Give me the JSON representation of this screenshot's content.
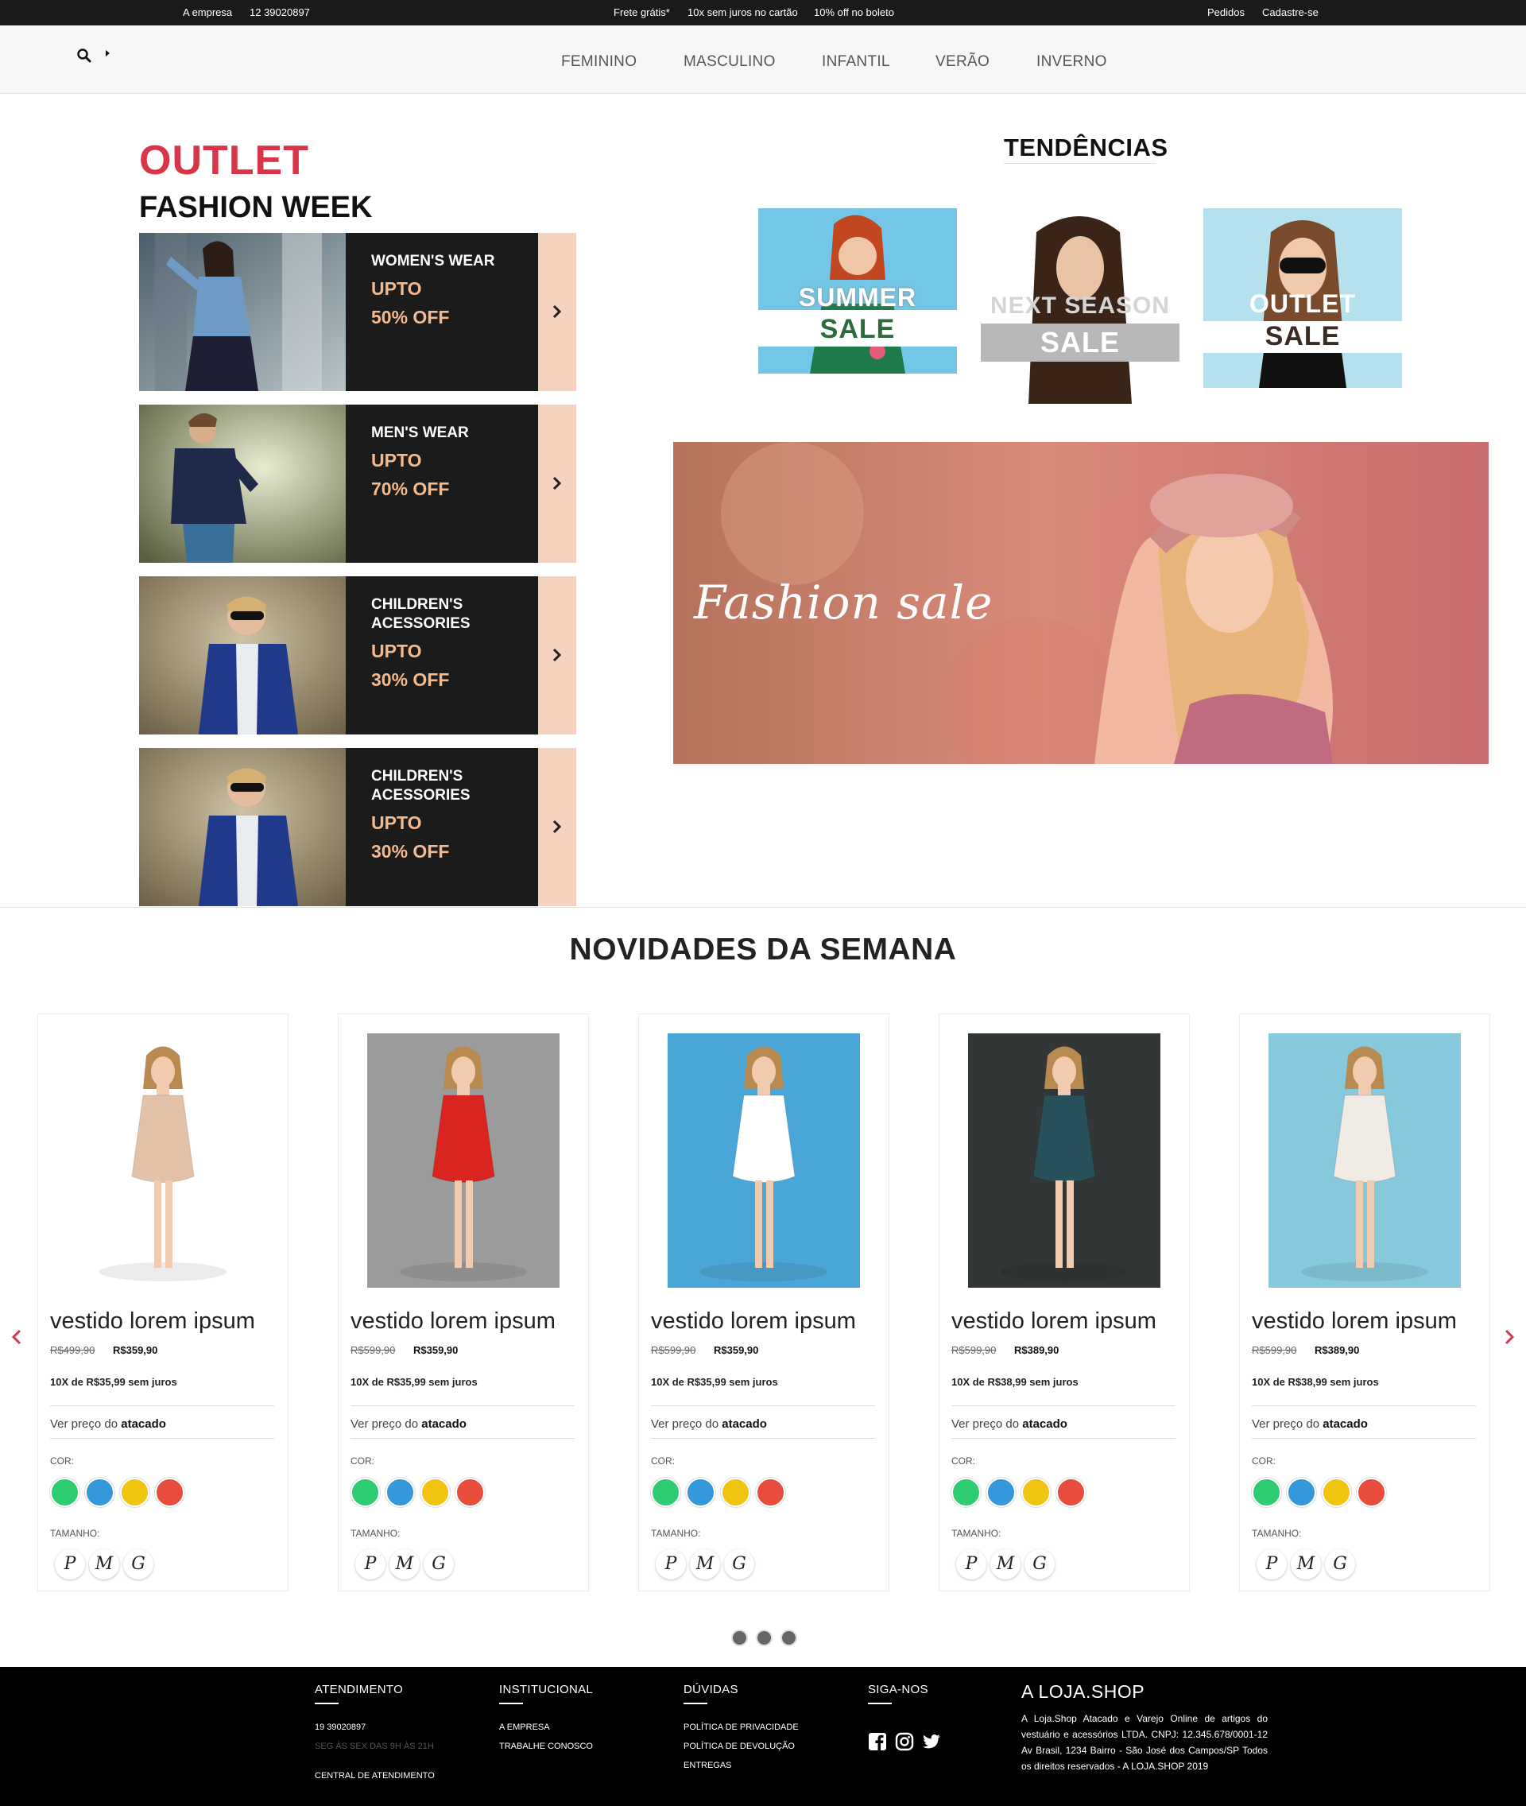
{
  "topbar": {
    "about": "A empresa",
    "phone": "12 39020897",
    "frete": "Frete grátis*",
    "juros": "10x sem juros no cartão",
    "boleto": "10% off no boleto",
    "pedidos": "Pedidos",
    "cadastro": "Cadastre-se"
  },
  "nav": {
    "items": [
      "FEMININO",
      "MASCULINO",
      "INFANTIL",
      "VERÃO",
      "INVERNO"
    ]
  },
  "outlet": {
    "title": "OUTLET",
    "subtitle": "FASHION WEEK",
    "promos": [
      {
        "category": "WOMEN'S WEAR",
        "upto": "UPTO",
        "off": "50% OFF"
      },
      {
        "category": "MEN'S WEAR",
        "upto": "UPTO",
        "off": "70% OFF"
      },
      {
        "category": "CHILDREN'S ACESSORIES",
        "upto": "UPTO",
        "off": "30% OFF"
      },
      {
        "category": "CHILDREN'S ACESSORIES",
        "upto": "UPTO",
        "off": "30% OFF"
      }
    ]
  },
  "trends": {
    "title": "TENDÊNCIAS",
    "cards": [
      {
        "line1": "SUMMER",
        "line2": "SALE"
      },
      {
        "line1": "NEXT SEASON",
        "line2": "SALE"
      },
      {
        "line1": "OUTLET",
        "line2": "SALE"
      }
    ]
  },
  "banner": {
    "text": "Fashion sale"
  },
  "news": {
    "title": "NOVIDADES DA SEMANA",
    "products": [
      {
        "name": "vestido lorem ipsum",
        "old_price": "R$499,90",
        "price": "R$359,90",
        "installments": "10X de R$35,99 sem juros"
      },
      {
        "name": "vestido lorem ipsum",
        "old_price": "R$599,90",
        "price": "R$359,90",
        "installments": "10X de R$35,99 sem juros"
      },
      {
        "name": "vestido lorem ipsum",
        "old_price": "R$599,90",
        "price": "R$359,90",
        "installments": "10X de R$35,99 sem juros"
      },
      {
        "name": "vestido lorem ipsum",
        "old_price": "R$599,90",
        "price": "R$389,90",
        "installments": "10X de R$38,99 sem juros"
      },
      {
        "name": "vestido lorem ipsum",
        "old_price": "R$599,90",
        "price": "R$389,90",
        "installments": "10X de R$38,99 sem juros"
      }
    ],
    "ver_preco": "Ver preço do",
    "atacado": "atacado",
    "cor_label": "COR:",
    "tamanho_label": "TAMANHO:",
    "sizes": [
      "P",
      "M",
      "G"
    ],
    "colors": [
      "#2ecc71",
      "#3498db",
      "#f1c40f",
      "#e74c3c"
    ]
  },
  "footer": {
    "atendimento": {
      "title": "ATENDIMENTO",
      "phone": "19 39020897",
      "hours": "SEG ÁS SEX DAS 9H ÀS 21H",
      "central": "CENTRAL DE ATENDIMENTO"
    },
    "institucional": {
      "title": "INSTITUCIONAL",
      "links": [
        "A EMPRESA",
        "TRABALHE CONOSCO"
      ]
    },
    "duvidas": {
      "title": "DÚVIDAS",
      "links": [
        "POLÍTICA DE PRIVACIDADE",
        "POLÍTICA DE DEVOLUÇÃO",
        "ENTREGAS"
      ]
    },
    "siga": {
      "title": "SIGA-NOS"
    },
    "brand": "A LOJA.SHOP",
    "about": "A Loja.Shop Atacado e Varejo Online de artigos do vestuário e acessórios LTDA. CNPJ: 12.345.678/0001-12 Av Brasil, 1234 Bairro - São José dos Campos/SP Todos os direitos reservados - A LOJA.SHOP 2019"
  }
}
